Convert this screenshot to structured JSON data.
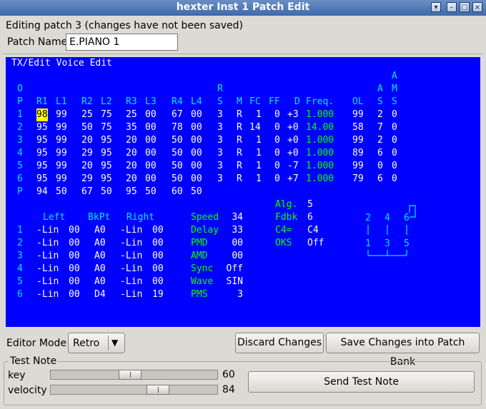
{
  "window": {
    "title": "hexter Inst 1 Patch Edit",
    "controls": {
      "menu": "▾",
      "minimize": "–",
      "maximize": "□",
      "close": "×"
    }
  },
  "status_text": "Editing patch 3 (changes have not been saved)",
  "patch_name": {
    "label": "Patch Name",
    "value": "E.PIANO 1"
  },
  "editor": {
    "title": "TX/Edit Voice Edit",
    "hdr_a": "A",
    "hdr1": {
      "o": "O",
      "r": "R",
      "a": "A",
      "m": "M"
    },
    "hdr2": {
      "p": "P",
      "r1": "R1",
      "l1": "L1",
      "r2": "R2",
      "l2": "L2",
      "r3": "R3",
      "l3": "L3",
      "r4": "R4",
      "l4": "L4",
      "s": "S",
      "m": "M",
      "fc": "FC",
      "ff": "FF",
      "d": "D",
      "freq": "Freq.",
      "ol": "OL",
      "v": "V",
      "s2": "S",
      "s3": "S"
    },
    "op_rows": [
      {
        "op": "1",
        "r1": "98",
        "l1": "99",
        "r2": "25",
        "l2": "75",
        "r3": "25",
        "l3": "00",
        "r4": "67",
        "l4": "00",
        "rs": "3",
        "m": "R",
        "fc": "1",
        "ff": "0",
        "d": "+3",
        "freq": "1.000",
        "ol": "99",
        "v": "2",
        "am": "0"
      },
      {
        "op": "2",
        "r1": "95",
        "l1": "99",
        "r2": "50",
        "l2": "75",
        "r3": "35",
        "l3": "00",
        "r4": "78",
        "l4": "00",
        "rs": "3",
        "m": "R",
        "fc": "14",
        "ff": "0",
        "d": "+0",
        "freq": "14.00",
        "ol": "58",
        "v": "7",
        "am": "0"
      },
      {
        "op": "3",
        "r1": "95",
        "l1": "99",
        "r2": "20",
        "l2": "95",
        "r3": "20",
        "l3": "00",
        "r4": "50",
        "l4": "00",
        "rs": "3",
        "m": "R",
        "fc": "1",
        "ff": "0",
        "d": "+0",
        "freq": "1.000",
        "ol": "99",
        "v": "2",
        "am": "0"
      },
      {
        "op": "4",
        "r1": "95",
        "l1": "99",
        "r2": "29",
        "l2": "95",
        "r3": "20",
        "l3": "00",
        "r4": "50",
        "l4": "00",
        "rs": "3",
        "m": "R",
        "fc": "1",
        "ff": "0",
        "d": "+0",
        "freq": "1.000",
        "ol": "89",
        "v": "6",
        "am": "0"
      },
      {
        "op": "5",
        "r1": "95",
        "l1": "99",
        "r2": "20",
        "l2": "95",
        "r3": "20",
        "l3": "00",
        "r4": "50",
        "l4": "00",
        "rs": "3",
        "m": "R",
        "fc": "1",
        "ff": "0",
        "d": "-7",
        "freq": "1.000",
        "ol": "99",
        "v": "0",
        "am": "0"
      },
      {
        "op": "6",
        "r1": "95",
        "l1": "99",
        "r2": "29",
        "l2": "95",
        "r3": "20",
        "l3": "00",
        "r4": "50",
        "l4": "00",
        "rs": "3",
        "m": "R",
        "fc": "1",
        "ff": "0",
        "d": "+7",
        "freq": "1.000",
        "ol": "79",
        "v": "6",
        "am": "0"
      }
    ],
    "pitch_row": {
      "label": "P",
      "r1": "94",
      "l1": "50",
      "r2": "67",
      "l2": "50",
      "r3": "95",
      "l3": "50",
      "r4": "60",
      "l4": "50"
    },
    "scaling_hdr": {
      "left": "Left",
      "bkpt": "BkPt",
      "right": "Right"
    },
    "scaling_rows": [
      {
        "op": "1",
        "left": "-Lin",
        "lv": "00",
        "bkpt": "A0",
        "right": "-Lin",
        "rv": "00"
      },
      {
        "op": "2",
        "left": "-Lin",
        "lv": "00",
        "bkpt": "A0",
        "right": "-Lin",
        "rv": "00"
      },
      {
        "op": "3",
        "left": "-Lin",
        "lv": "00",
        "bkpt": "A0",
        "right": "-Lin",
        "rv": "00"
      },
      {
        "op": "4",
        "left": "-Lin",
        "lv": "00",
        "bkpt": "A0",
        "right": "-Lin",
        "rv": "00"
      },
      {
        "op": "5",
        "left": "-Lin",
        "lv": "00",
        "bkpt": "A0",
        "right": "-Lin",
        "rv": "00"
      },
      {
        "op": "6",
        "left": "-Lin",
        "lv": "00",
        "bkpt": "D4",
        "right": "-Lin",
        "rv": "19"
      }
    ],
    "lfo": [
      {
        "label": "Speed",
        "value": "34"
      },
      {
        "label": "Delay",
        "value": "33"
      },
      {
        "label": "PMD",
        "value": "00"
      },
      {
        "label": "AMD",
        "value": "00"
      },
      {
        "label": "Sync",
        "value": "Off"
      },
      {
        "label": "Wave",
        "value": "SIN"
      },
      {
        "label": "PMS",
        "value": "3"
      }
    ],
    "global": [
      {
        "label": "Alg.",
        "value": "5"
      },
      {
        "label": "Fdbk",
        "value": "6"
      },
      {
        "label": "C4=",
        "value": "C4"
      },
      {
        "label": "OKS",
        "value": "Off"
      }
    ],
    "algorithm": {
      "top": [
        "2",
        "4",
        "6"
      ],
      "bottom": [
        "1",
        "3",
        "5"
      ]
    }
  },
  "editor_mode": {
    "label": "Editor Mode",
    "value": "Retro",
    "arrow": "▼"
  },
  "buttons": {
    "discard": "Discard Changes",
    "save": "Save Changes into Patch Bank",
    "send": "Send Test Note"
  },
  "test_note": {
    "group_label": "Test Note",
    "key": {
      "label": "key",
      "value": "60",
      "level": 0.47
    },
    "velocity": {
      "label": "velocity",
      "value": "84",
      "level": 0.66
    }
  },
  "colors": {
    "editor_bg": "#0000ff",
    "label_text": "#00e8e8",
    "value_text": "#ffffff",
    "alt_text": "#00ff00",
    "cursor": "#ffff00",
    "titlebar": "#4a76b4"
  }
}
